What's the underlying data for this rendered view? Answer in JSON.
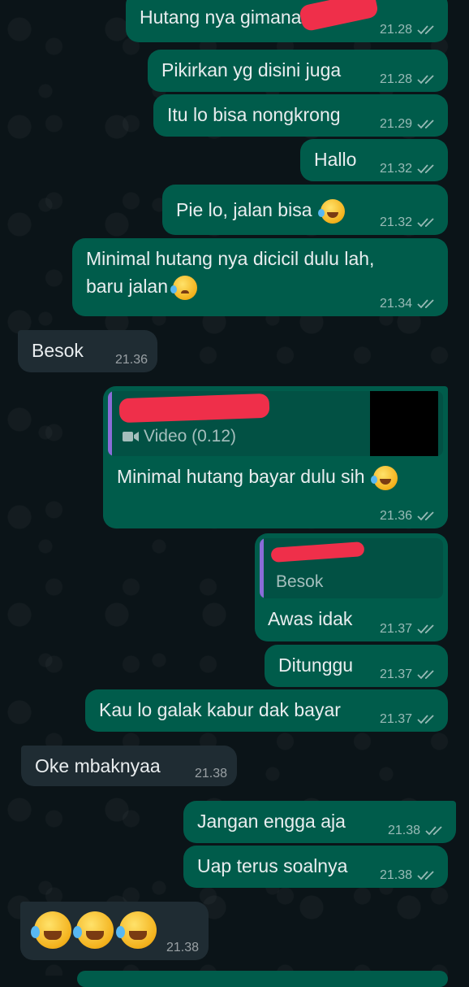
{
  "messages": [
    {
      "text": "Hutang nya gimana p",
      "time": "21.28"
    },
    {
      "text": "Pikirkan yg disini juga",
      "time": "21.28"
    },
    {
      "text": "Itu lo bisa nongkrong",
      "time": "21.29"
    },
    {
      "text": "Hallo",
      "time": "21.32"
    },
    {
      "text": "Pie lo, jalan bisa",
      "time": "21.32",
      "emoji": "rolling-on-floor-laughing"
    },
    {
      "text": "Minimal hutang nya dicicil dulu lah,",
      "text2": "baru jalan",
      "time": "21.34",
      "emoji": "crying-face"
    },
    {
      "text": "Besok",
      "time": "21.36"
    },
    {
      "reply_media_label": "Video (0.12)",
      "text": "Minimal hutang bayar dulu sih",
      "time": "21.36",
      "emoji": "rolling-on-floor-laughing"
    },
    {
      "reply_text": "Besok",
      "text": "Awas idak",
      "time": "21.37"
    },
    {
      "text": "Ditunggu",
      "time": "21.37"
    },
    {
      "text": "Kau lo galak kabur dak bayar",
      "time": "21.37"
    },
    {
      "text": "Oke mbaknyaa",
      "time": "21.38"
    },
    {
      "text": "Jangan engga aja",
      "time": "21.38"
    },
    {
      "text": "Uap terus soalnya",
      "time": "21.38"
    },
    {
      "time": "21.38",
      "emoji": "rolling-on-floor-laughing x3"
    }
  ],
  "colors": {
    "outgoing": "#005c4b",
    "incoming": "#1f2c33",
    "background": "#0b1418",
    "redaction": "#ef2f4a"
  }
}
